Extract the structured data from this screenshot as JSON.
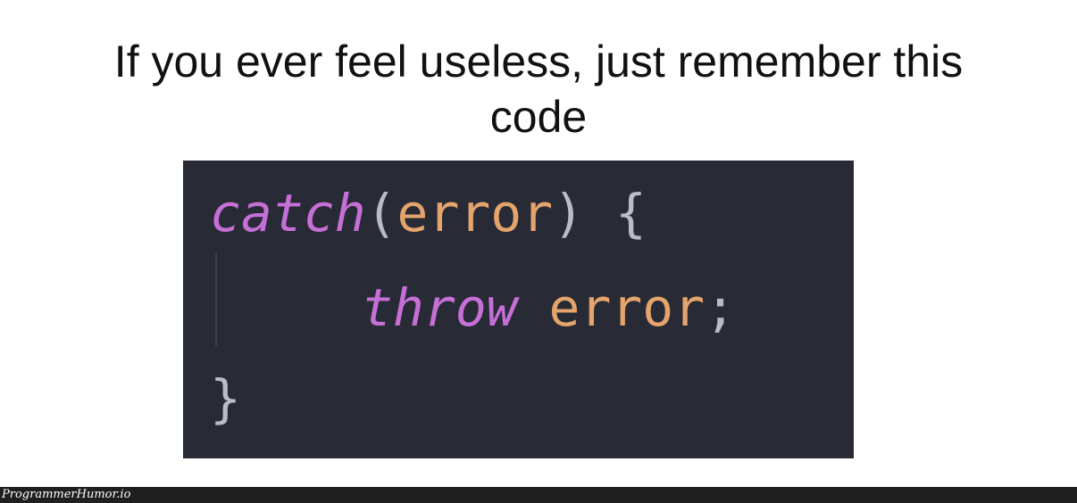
{
  "caption": {
    "line1": "If you ever feel useless, just remember this",
    "line2": "code"
  },
  "code": {
    "line1": {
      "keyword": "catch",
      "open_paren": "(",
      "param": "error",
      "close_paren": ")",
      "space": " ",
      "brace": "{"
    },
    "line2": {
      "keyword": "throw",
      "space": " ",
      "ident": "error",
      "semicolon": ";"
    },
    "line3": {
      "brace": "}"
    }
  },
  "footer": {
    "watermark": "ProgrammerHumor.io"
  },
  "colors": {
    "code_background": "#282a36",
    "keyword": "#c66fd6",
    "identifier": "#e5a46c",
    "punctuation": "#b8bcc6",
    "footer_background": "#1f1f1f"
  }
}
